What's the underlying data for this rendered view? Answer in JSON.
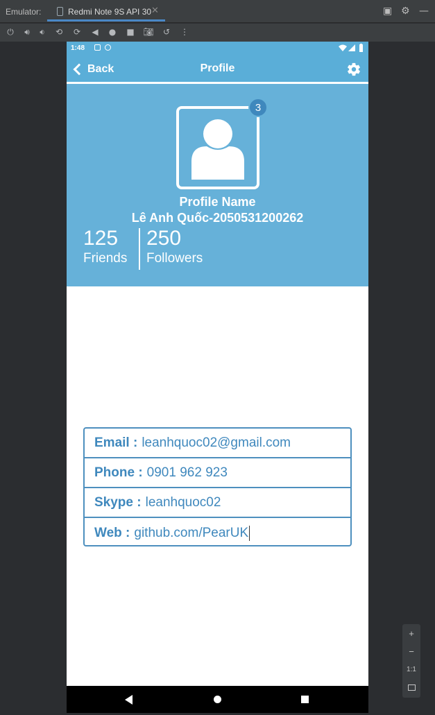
{
  "emulator": {
    "label": "Emulator:",
    "tab_title": "Redmi Note 9S API 30",
    "zoom_in": "+",
    "zoom_out": "−",
    "one_to_one": "1:1"
  },
  "status_bar": {
    "time": "1:48"
  },
  "app_bar": {
    "back_label": "Back",
    "title": "Profile",
    "settings_icon": "gear-icon"
  },
  "profile": {
    "notification_count": "3",
    "name": "Profile Name",
    "subtitle": "Lê Anh Quốc-2050531200262",
    "stats": [
      {
        "value": "125",
        "label": "Friends"
      },
      {
        "value": "250",
        "label": "Followers"
      }
    ]
  },
  "contact": {
    "rows": [
      {
        "key": "Email :",
        "value": "leanhquoc02@gmail.com"
      },
      {
        "key": "Phone :",
        "value": "0901 962 923"
      },
      {
        "key": "Skype :",
        "value": "leanhquoc02"
      },
      {
        "key": "Web :",
        "value": "github.com/PearUK"
      }
    ]
  },
  "colors": {
    "accent": "#66b1d9",
    "text_accent": "#3f88bd"
  }
}
